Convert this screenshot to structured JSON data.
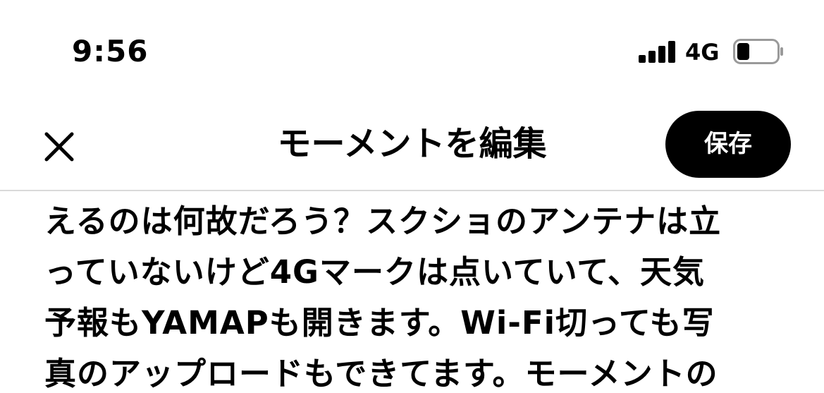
{
  "status_bar": {
    "time": "9:56",
    "network": "4G",
    "signal_bars": 4,
    "battery_level": 0.3,
    "signal-icon": "cellular-signal-icon",
    "battery-icon": "battery-icon"
  },
  "header": {
    "title": "モーメントを編集",
    "save_label": "保存",
    "close_icon": "close-icon"
  },
  "content": {
    "text": "えるのは何故だろう？スクショのアンテナは立\nっていないけど4Gマークは点いていて、天気\n予報もYAMAPも開きます。Wi-Fi切っても写\n真のアップロードもできてます。モーメントの"
  }
}
